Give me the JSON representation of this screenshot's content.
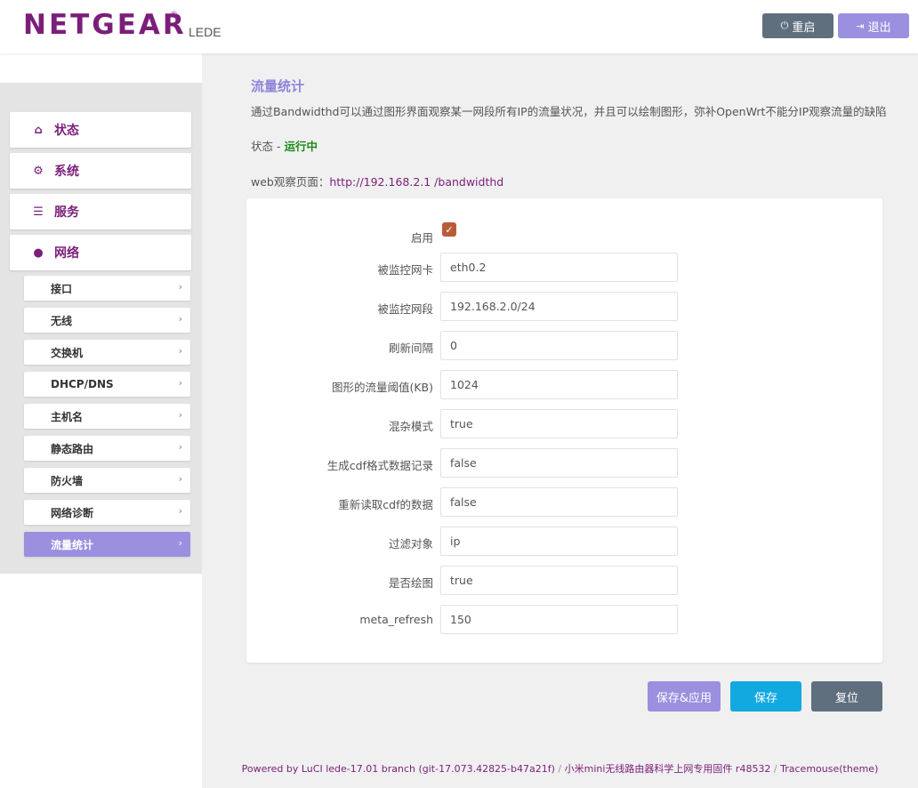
{
  "header": {
    "brand": "NETGEAR",
    "brand_mark": "®",
    "subtitle": "LEDE",
    "reboot_label": "重启",
    "logout_label": "退出"
  },
  "sidebar": {
    "main_items": [
      {
        "label": "状态",
        "icon": "home-icon"
      },
      {
        "label": "系统",
        "icon": "gears-icon"
      },
      {
        "label": "服务",
        "icon": "list-icon"
      },
      {
        "label": "网络",
        "icon": "globe-icon"
      }
    ],
    "sub_items": [
      {
        "label": "接口"
      },
      {
        "label": "无线"
      },
      {
        "label": "交换机"
      },
      {
        "label": "DHCP/DNS"
      },
      {
        "label": "主机名"
      },
      {
        "label": "静态路由"
      },
      {
        "label": "防火墙"
      },
      {
        "label": "网络诊断"
      },
      {
        "label": "流量统计",
        "active": true
      }
    ]
  },
  "main": {
    "title": "流量统计",
    "description": "通过Bandwidthd可以通过图形界面观察某一网段所有IP的流量状况，并且可以绘制图形，弥补OpenWrt不能分IP观察流量的缺陷",
    "status_label": "状态 - ",
    "status_value": "运行中",
    "web_label": "web观察页面：",
    "web_link": "http://192.168.2.1 /bandwidthd",
    "form": {
      "enable_label": "启用",
      "enabled": true,
      "fields": [
        {
          "label": "被监控网卡",
          "value": "eth0.2"
        },
        {
          "label": "被监控网段",
          "value": "192.168.2.0/24"
        },
        {
          "label": "刷新间隔",
          "value": "0"
        },
        {
          "label": "图形的流量阈值(KB)",
          "value": "1024"
        },
        {
          "label": "混杂模式",
          "value": "true"
        },
        {
          "label": "生成cdf格式数据记录",
          "value": "false"
        },
        {
          "label": "重新读取cdf的数据",
          "value": "false"
        },
        {
          "label": "过滤对象",
          "value": "ip"
        },
        {
          "label": "是否绘图",
          "value": "true"
        },
        {
          "label": "meta_refresh",
          "value": "150"
        }
      ]
    },
    "buttons": {
      "save_apply": "保存&应用",
      "save": "保存",
      "reset": "复位"
    }
  },
  "footer": {
    "powered": "Powered by LuCI lede-17.01 branch (git-17.073.42825-b47a21f)",
    "sep": " / ",
    "firmware": "小米mini无线路由器科学上网专用固件 r48532",
    "theme": "Tracemouse(theme)"
  },
  "colors": {
    "brand": "#7b1e7a",
    "accent": "#9b8fe0",
    "save_blue": "#12a9e0",
    "dark_button": "#5f6f7e",
    "status_green": "#1a8a1a"
  }
}
